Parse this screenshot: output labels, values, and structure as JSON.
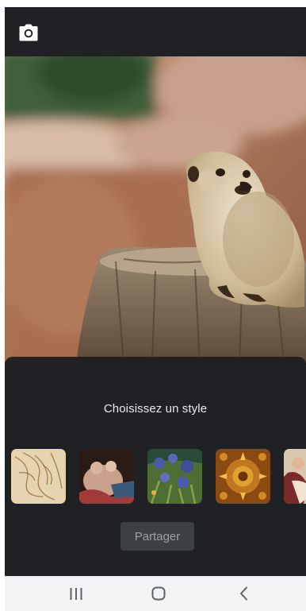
{
  "toolbar": {
    "camera_icon": "camera-icon"
  },
  "photo": {
    "subject": "meerkat-photo"
  },
  "sheet": {
    "title": "Choisissez un style",
    "styles": [
      {
        "name": "sketch-style",
        "colors": [
          "#e6d3b0",
          "#b69563"
        ]
      },
      {
        "name": "baroque-painting-style",
        "colors": [
          "#2a1b16",
          "#a33a3a"
        ]
      },
      {
        "name": "irises-style",
        "colors": [
          "#2e5a7a",
          "#5b7a3a"
        ]
      },
      {
        "name": "gold-ornament-style",
        "colors": [
          "#8a4a12",
          "#e0a030"
        ]
      },
      {
        "name": "classical-painting-style",
        "colors": [
          "#d8c8b0",
          "#7a2a2a"
        ]
      }
    ],
    "share_label": "Partager"
  },
  "navbar": {
    "recents_icon": "recents-icon",
    "home_icon": "home-icon",
    "back_icon": "back-icon"
  },
  "colors": {
    "background": "#202124",
    "text": "#e8eaed",
    "button_bg": "#3c4043",
    "button_text": "#9aa0a6",
    "navbar_bg": "#f1f3f4"
  }
}
